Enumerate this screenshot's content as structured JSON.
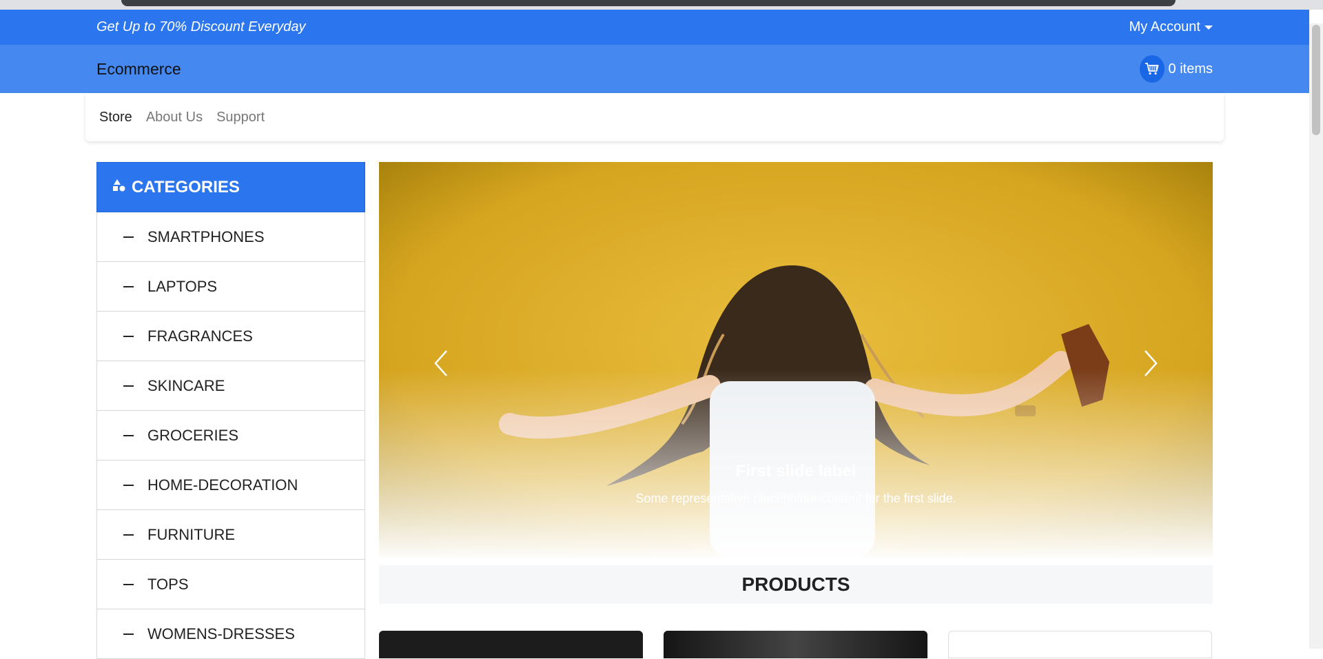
{
  "topbar": {
    "promo": "Get Up to 70% Discount Everyday",
    "account_label": "My Account"
  },
  "brandbar": {
    "brand": "Ecommerce",
    "cart_label": "0 items"
  },
  "nav": {
    "links": [
      "Store",
      "About Us",
      "Support"
    ]
  },
  "sidebar": {
    "header": "CATEGORIES",
    "items": [
      "SMARTPHONES",
      "LAPTOPS",
      "FRAGRANCES",
      "SKINCARE",
      "GROCERIES",
      "HOME-DECORATION",
      "FURNITURE",
      "TOPS",
      "WOMENS-DRESSES"
    ]
  },
  "carousel": {
    "caption_title": "First slide label",
    "caption_text": "Some representative placeholder content for the first slide."
  },
  "products": {
    "title": "PRODUCTS"
  },
  "colors": {
    "primary": "#2b76ee",
    "brandbar": "#4588ef",
    "carousel_bg": "#d9a825"
  },
  "icons": {
    "cart": "cart-icon",
    "categories": "shapes-icon",
    "prev": "chevron-left-icon",
    "next": "chevron-right-icon"
  }
}
